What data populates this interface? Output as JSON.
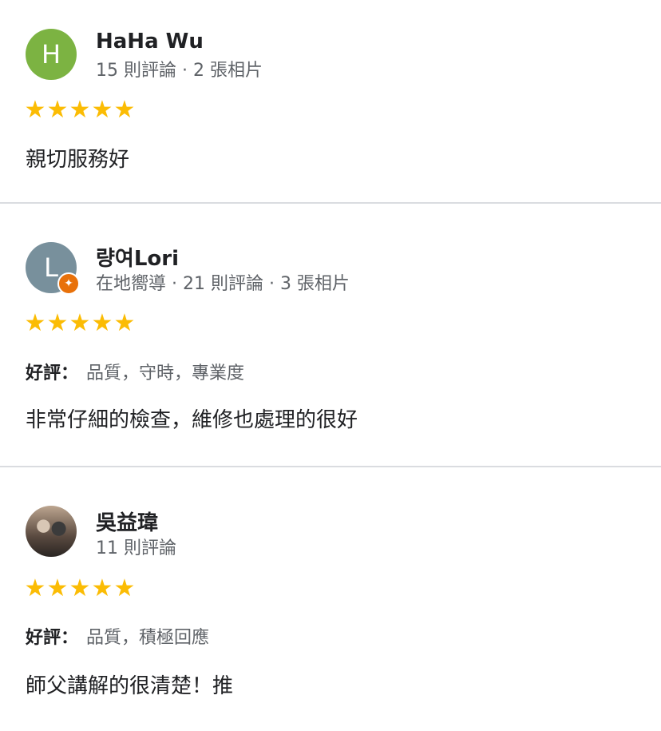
{
  "reviews": [
    {
      "avatar_letter": "H",
      "avatar_color": "#7cb342",
      "name": "HaHa Wu",
      "meta": "15 則評論 · 2 張相片",
      "rating": 5,
      "star": "★★★★★",
      "tags_label": "",
      "tags": "",
      "text": "親切服務好"
    },
    {
      "avatar_letter": "L",
      "avatar_color": "#78909c",
      "badge_icon": "✦",
      "name": "량여Lori",
      "meta": "在地嚮導 · 21 則評論 · 3 張相片",
      "rating": 5,
      "star": "★★★★★",
      "tags_label": "好評：",
      "tags": "品質，守時，專業度",
      "text": "非常仔細的檢查，維修也處理的很好"
    },
    {
      "avatar_letter": "",
      "name": "吳益瑋",
      "meta": "11 則評論",
      "rating": 5,
      "star": "★★★★★",
      "tags_label": "好評：",
      "tags": "品質，積極回應",
      "text": "師父講解的很清楚！推"
    }
  ],
  "colors": {
    "star": "#fbbc04",
    "divider": "#dadce0",
    "guide_badge": "#e8710a"
  }
}
